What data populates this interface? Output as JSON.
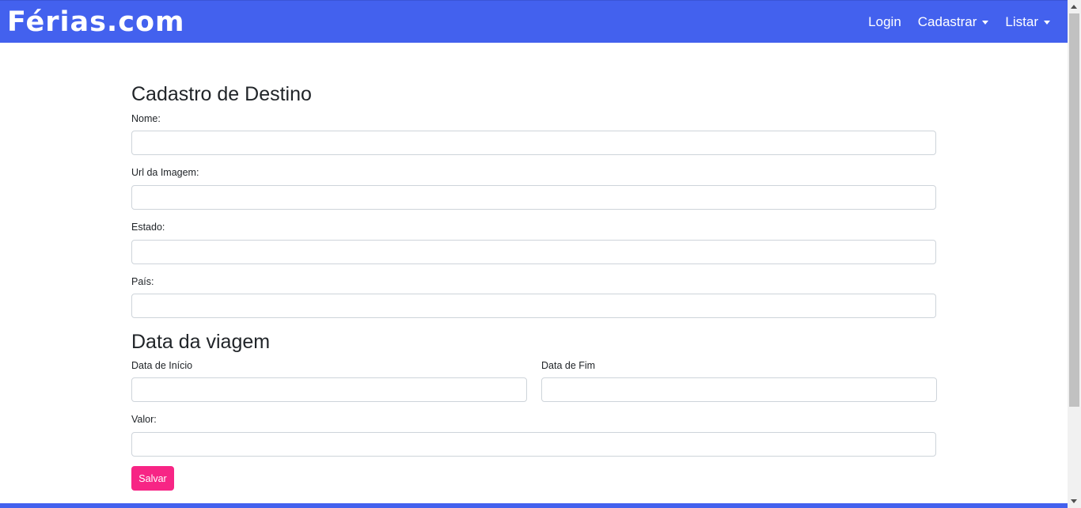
{
  "navbar": {
    "brand": "Férias.com",
    "links": {
      "login": "Login",
      "cadastrar": "Cadastrar",
      "listar": "Listar"
    },
    "color": "#4361ee"
  },
  "form": {
    "title": "Cadastro de Destino",
    "nome_label": "Nome:",
    "url_label": "Url da Imagem:",
    "estado_label": "Estado:",
    "pais_label": "País:",
    "trip_title": "Data da viagem",
    "inicio_label": "Data de Início",
    "fim_label": "Data de Fim",
    "valor_label": "Valor:",
    "values": {
      "nome": "",
      "url": "",
      "estado": "",
      "pais": "",
      "inicio": "",
      "fim": "",
      "valor": ""
    },
    "save_label": "Salvar",
    "save_color": "#f72585"
  }
}
